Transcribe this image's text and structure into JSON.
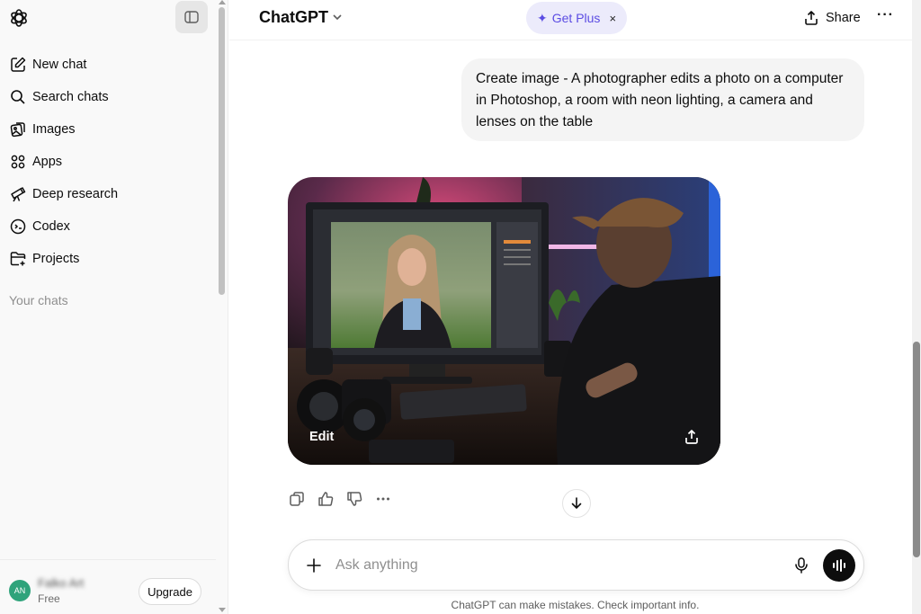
{
  "sidebar": {
    "logo_icon": "openai-logo-icon",
    "collapse_icon": "sidebar-toggle-icon",
    "items": [
      {
        "label": "New chat",
        "icon": "edit-icon"
      },
      {
        "label": "Search chats",
        "icon": "search-icon"
      },
      {
        "label": "Images",
        "icon": "images-icon"
      },
      {
        "label": "Apps",
        "icon": "apps-grid-icon"
      },
      {
        "label": "Deep research",
        "icon": "telescope-icon"
      },
      {
        "label": "Codex",
        "icon": "codex-icon"
      },
      {
        "label": "Projects",
        "icon": "folder-plus-icon"
      }
    ],
    "section_label": "Your chats",
    "footer": {
      "avatar_initials": "AN",
      "username": "Falko Art",
      "plan": "Free",
      "upgrade_label": "Upgrade"
    }
  },
  "header": {
    "model_title": "ChatGPT",
    "get_plus_label": "Get Plus",
    "get_plus_close": "×",
    "share_label": "Share",
    "more_label": "···"
  },
  "conversation": {
    "user_message": "Create image - A photographer edits a photo on a computer in Photoshop, a room with neon lighting, a camera and lenses on the table",
    "image_edit_label": "Edit"
  },
  "composer": {
    "placeholder": "Ask anything"
  },
  "footer": {
    "disclaimer": "ChatGPT can make mistakes. Check important info."
  },
  "colors": {
    "accent_purple": "#5b4ce3",
    "get_plus_bg": "#ecebfb",
    "avatar_green": "#2fa37b",
    "sidebar_bg": "#f9f9f9",
    "bubble_bg": "#f4f4f4"
  }
}
